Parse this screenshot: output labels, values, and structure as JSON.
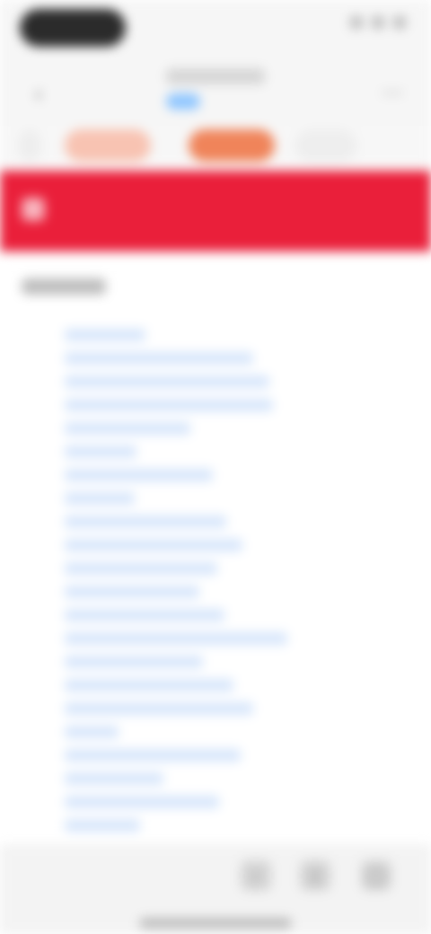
{
  "status_bar": {
    "time": "",
    "icons": [
      "signal-icon",
      "wifi-icon",
      "battery-icon"
    ]
  },
  "top_bar": {
    "title": "",
    "subtitle": ""
  },
  "chips": [
    {
      "label": ""
    },
    {
      "label": ""
    },
    {
      "label": ""
    },
    {
      "label": ""
    }
  ],
  "banner": {
    "text": ""
  },
  "content": {
    "section_title": "",
    "links": [
      {
        "label": ""
      },
      {
        "label": ""
      },
      {
        "label": ""
      },
      {
        "label": ""
      },
      {
        "label": ""
      },
      {
        "label": ""
      },
      {
        "label": ""
      },
      {
        "label": ""
      },
      {
        "label": ""
      },
      {
        "label": ""
      },
      {
        "label": ""
      },
      {
        "label": ""
      },
      {
        "label": ""
      },
      {
        "label": ""
      },
      {
        "label": ""
      },
      {
        "label": ""
      },
      {
        "label": ""
      },
      {
        "label": ""
      },
      {
        "label": ""
      },
      {
        "label": ""
      },
      {
        "label": ""
      },
      {
        "label": ""
      }
    ]
  },
  "bottom_nav": {
    "items": [
      {
        "icon": "search-icon"
      },
      {
        "icon": "bookmark-icon"
      },
      {
        "icon": "profile-icon"
      }
    ]
  },
  "colors": {
    "banner": "#ea1f3a",
    "chip_active": "#f0845a",
    "chip": "#f8c3b2",
    "link": "#4a8bd9"
  }
}
